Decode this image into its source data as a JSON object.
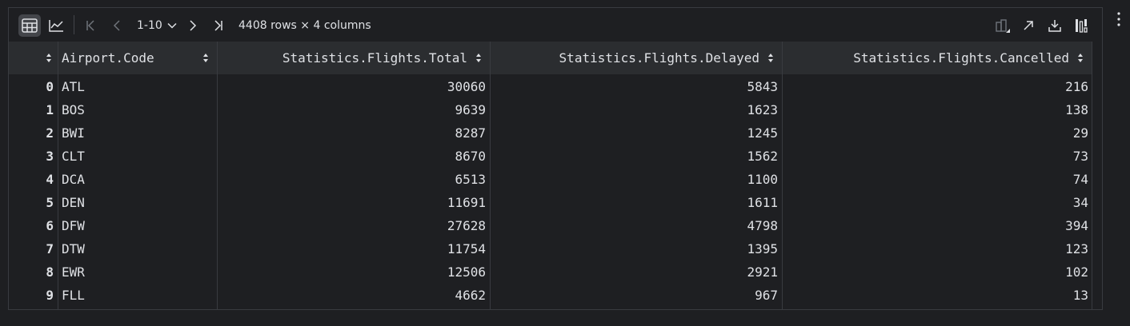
{
  "toolbar": {
    "page_range": "1-10",
    "row_info": "4408 rows × 4 columns"
  },
  "icons": {
    "table_view": "table-icon",
    "chart_view": "chart-icon",
    "first_page": "first-page-icon",
    "prev_page": "prev-page-icon",
    "page_dropdown": "chevron-down-icon",
    "next_page": "next-page-icon",
    "last_page": "last-page-icon",
    "compare": "compare-icon",
    "open_external": "open-external-icon",
    "download": "download-icon",
    "settings": "column-settings-icon",
    "more": "more-vertical-icon"
  },
  "columns": [
    {
      "label": ""
    },
    {
      "label": "Airport.Code"
    },
    {
      "label": "Statistics.Flights.Total"
    },
    {
      "label": "Statistics.Flights.Delayed"
    },
    {
      "label": "Statistics.Flights.Cancelled"
    }
  ],
  "rows": [
    {
      "idx": "0",
      "code": "ATL",
      "total": "30060",
      "delayed": "5843",
      "cancelled": "216"
    },
    {
      "idx": "1",
      "code": "BOS",
      "total": "9639",
      "delayed": "1623",
      "cancelled": "138"
    },
    {
      "idx": "2",
      "code": "BWI",
      "total": "8287",
      "delayed": "1245",
      "cancelled": "29"
    },
    {
      "idx": "3",
      "code": "CLT",
      "total": "8670",
      "delayed": "1562",
      "cancelled": "73"
    },
    {
      "idx": "4",
      "code": "DCA",
      "total": "6513",
      "delayed": "1100",
      "cancelled": "74"
    },
    {
      "idx": "5",
      "code": "DEN",
      "total": "11691",
      "delayed": "1611",
      "cancelled": "34"
    },
    {
      "idx": "6",
      "code": "DFW",
      "total": "27628",
      "delayed": "4798",
      "cancelled": "394"
    },
    {
      "idx": "7",
      "code": "DTW",
      "total": "11754",
      "delayed": "1395",
      "cancelled": "123"
    },
    {
      "idx": "8",
      "code": "EWR",
      "total": "12506",
      "delayed": "2921",
      "cancelled": "102"
    },
    {
      "idx": "9",
      "code": "FLL",
      "total": "4662",
      "delayed": "967",
      "cancelled": "13"
    }
  ],
  "colors": {
    "background": "#1e1f22",
    "header_bg": "#2b2d30",
    "border": "#393b40",
    "text": "#dfe1e5",
    "muted_icon": "#6f737a"
  }
}
